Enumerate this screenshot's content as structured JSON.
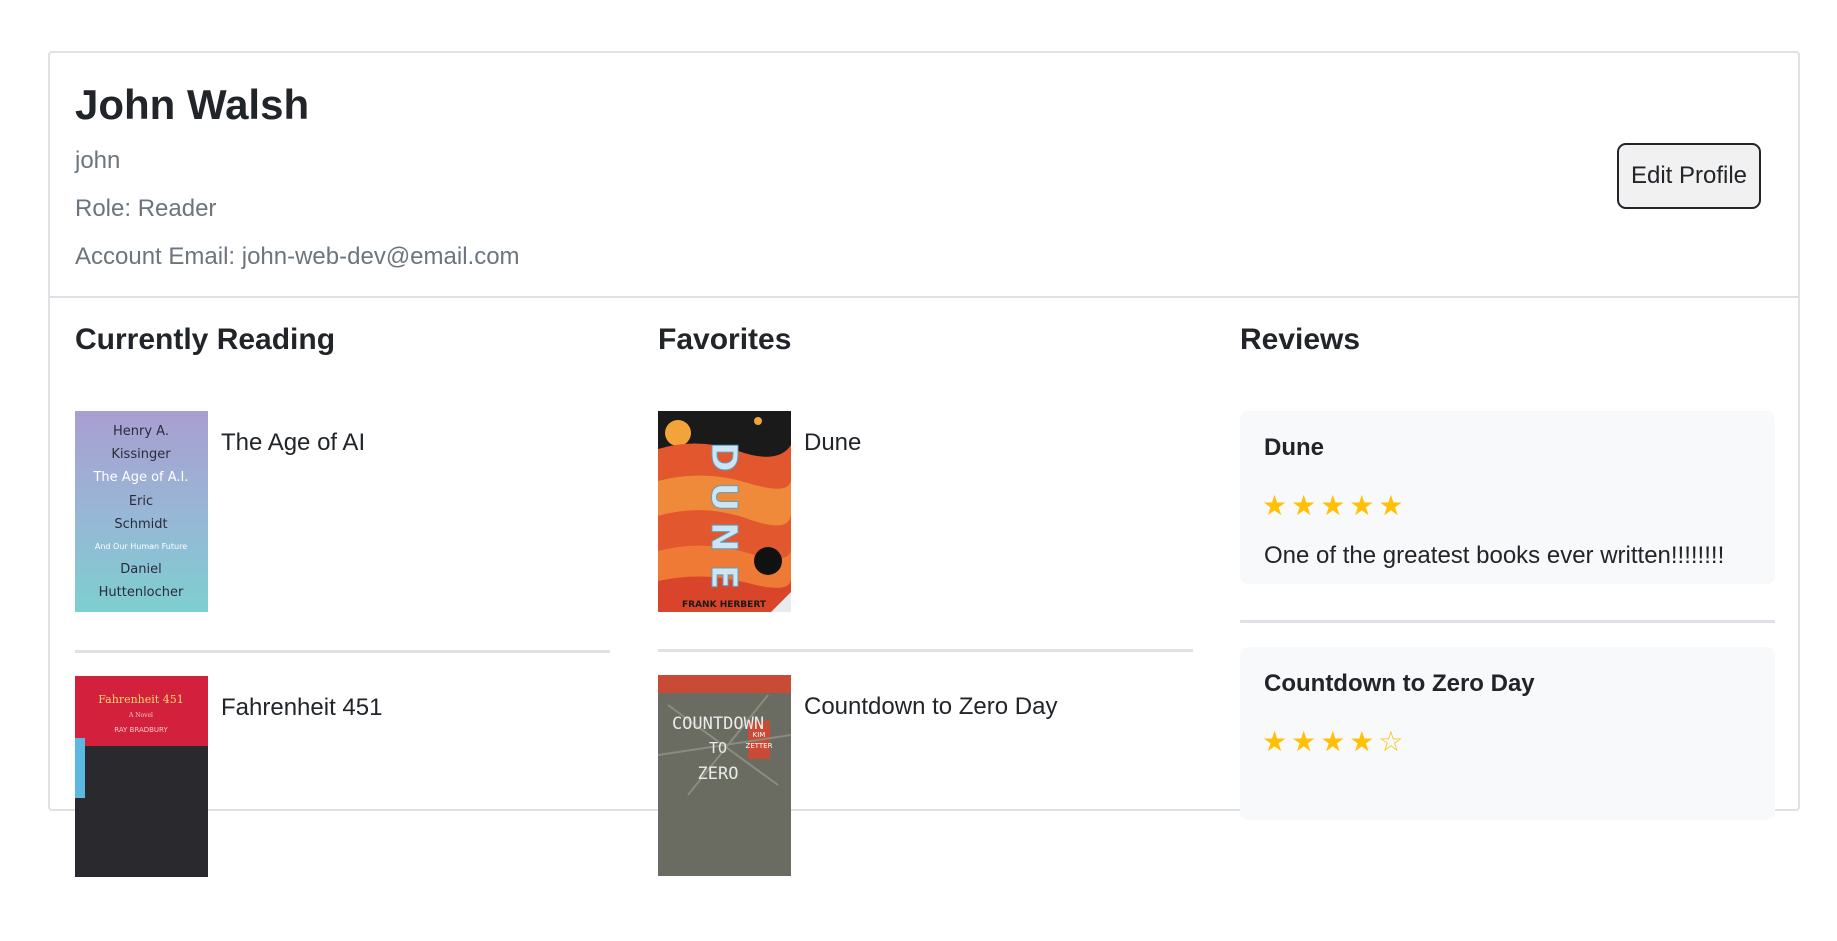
{
  "profile": {
    "name": "John Walsh",
    "username": "john",
    "role": "Role: Reader",
    "email": "Account Email: john-web-dev@email.com",
    "edit_label": "Edit Profile"
  },
  "currently_reading": {
    "title": "Currently Reading",
    "books": [
      {
        "title": "The Age of AI",
        "cover_lines": [
          "Henry A.",
          "Kissinger",
          "The Age of A.I.",
          "Eric",
          "Schmidt",
          "And Our Human Future",
          "Daniel",
          "Huttenlocher"
        ]
      },
      {
        "title": "Fahrenheit 451",
        "cover_lines": [
          "Fahrenheit 451",
          "A Novel",
          "RAY BRADBURY"
        ]
      }
    ]
  },
  "favorites": {
    "title": "Favorites",
    "books": [
      {
        "title": "Dune",
        "cover_lines": [
          "DUNE",
          "FRANK HERBERT"
        ]
      },
      {
        "title": "Countdown to Zero Day",
        "cover_lines": [
          "COUNTDOWN",
          "TO",
          "ZERO",
          "KIM",
          "ZETTER"
        ]
      }
    ]
  },
  "reviews": {
    "title": "Reviews",
    "items": [
      {
        "book": "Dune",
        "rating": 5,
        "max": 5,
        "stars": "★★★★★",
        "text": "One of the greatest books ever written!!!!!!!!"
      },
      {
        "book": "Countdown to Zero Day",
        "rating": 4,
        "max": 5,
        "stars": "★★★★☆",
        "text": ""
      }
    ]
  },
  "colors": {
    "border": "#dee2e6",
    "muted_text": "#6c757d",
    "star": "#ffc107",
    "review_bg": "#f8f9fa"
  }
}
